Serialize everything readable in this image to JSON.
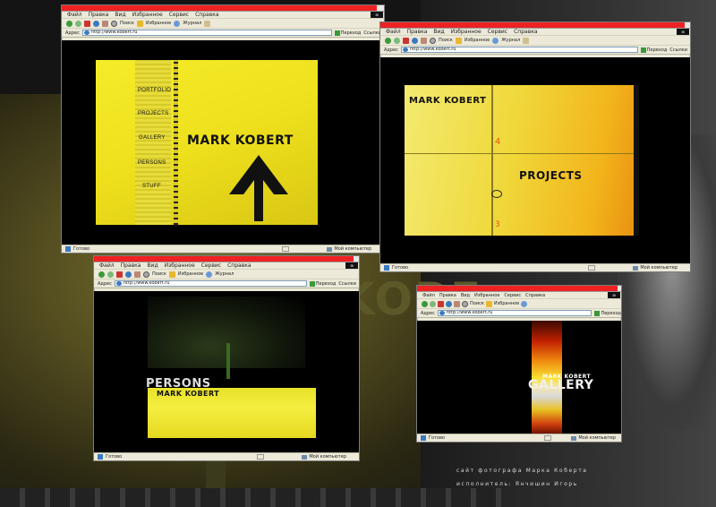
{
  "browser": {
    "menu": [
      "Файл",
      "Правка",
      "Вид",
      "Избранное",
      "Сервис",
      "Справка"
    ],
    "toolbar": {
      "search": "Поиск",
      "favorites": "Избранное",
      "history": "Журнал"
    },
    "address_label": "Адрес",
    "go_label": "Переход",
    "links_label": "Ссылки",
    "status_ready": "Готово",
    "status_zone": "Мой компьютер"
  },
  "windows": [
    {
      "url": "http://www.kobert.ru"
    },
    {
      "url": "http://www.kobert.ru"
    },
    {
      "url": "http://www.kobert.ru"
    },
    {
      "url": "http://www.kobert.ru"
    }
  ],
  "site": {
    "name": "MARK KOBERT",
    "menu": [
      "PORTFOLIO",
      "PROJECTS",
      "GALLERY",
      "PERSONS",
      "STUFF"
    ],
    "section_projects": "PROJECTS",
    "section_persons": "PERSONS",
    "section_gallery": "GALLERY",
    "num_4": "4",
    "num_3": "3"
  },
  "caption": {
    "line1": "сайт фотографа Марка Коберта",
    "line2": "исполнитель: Янчишин Игорь"
  },
  "background_text": "KOBE",
  "colors": {
    "site_yellow": "#f2e424",
    "title_red": "#e22222",
    "window_chrome": "#ece9d8"
  }
}
